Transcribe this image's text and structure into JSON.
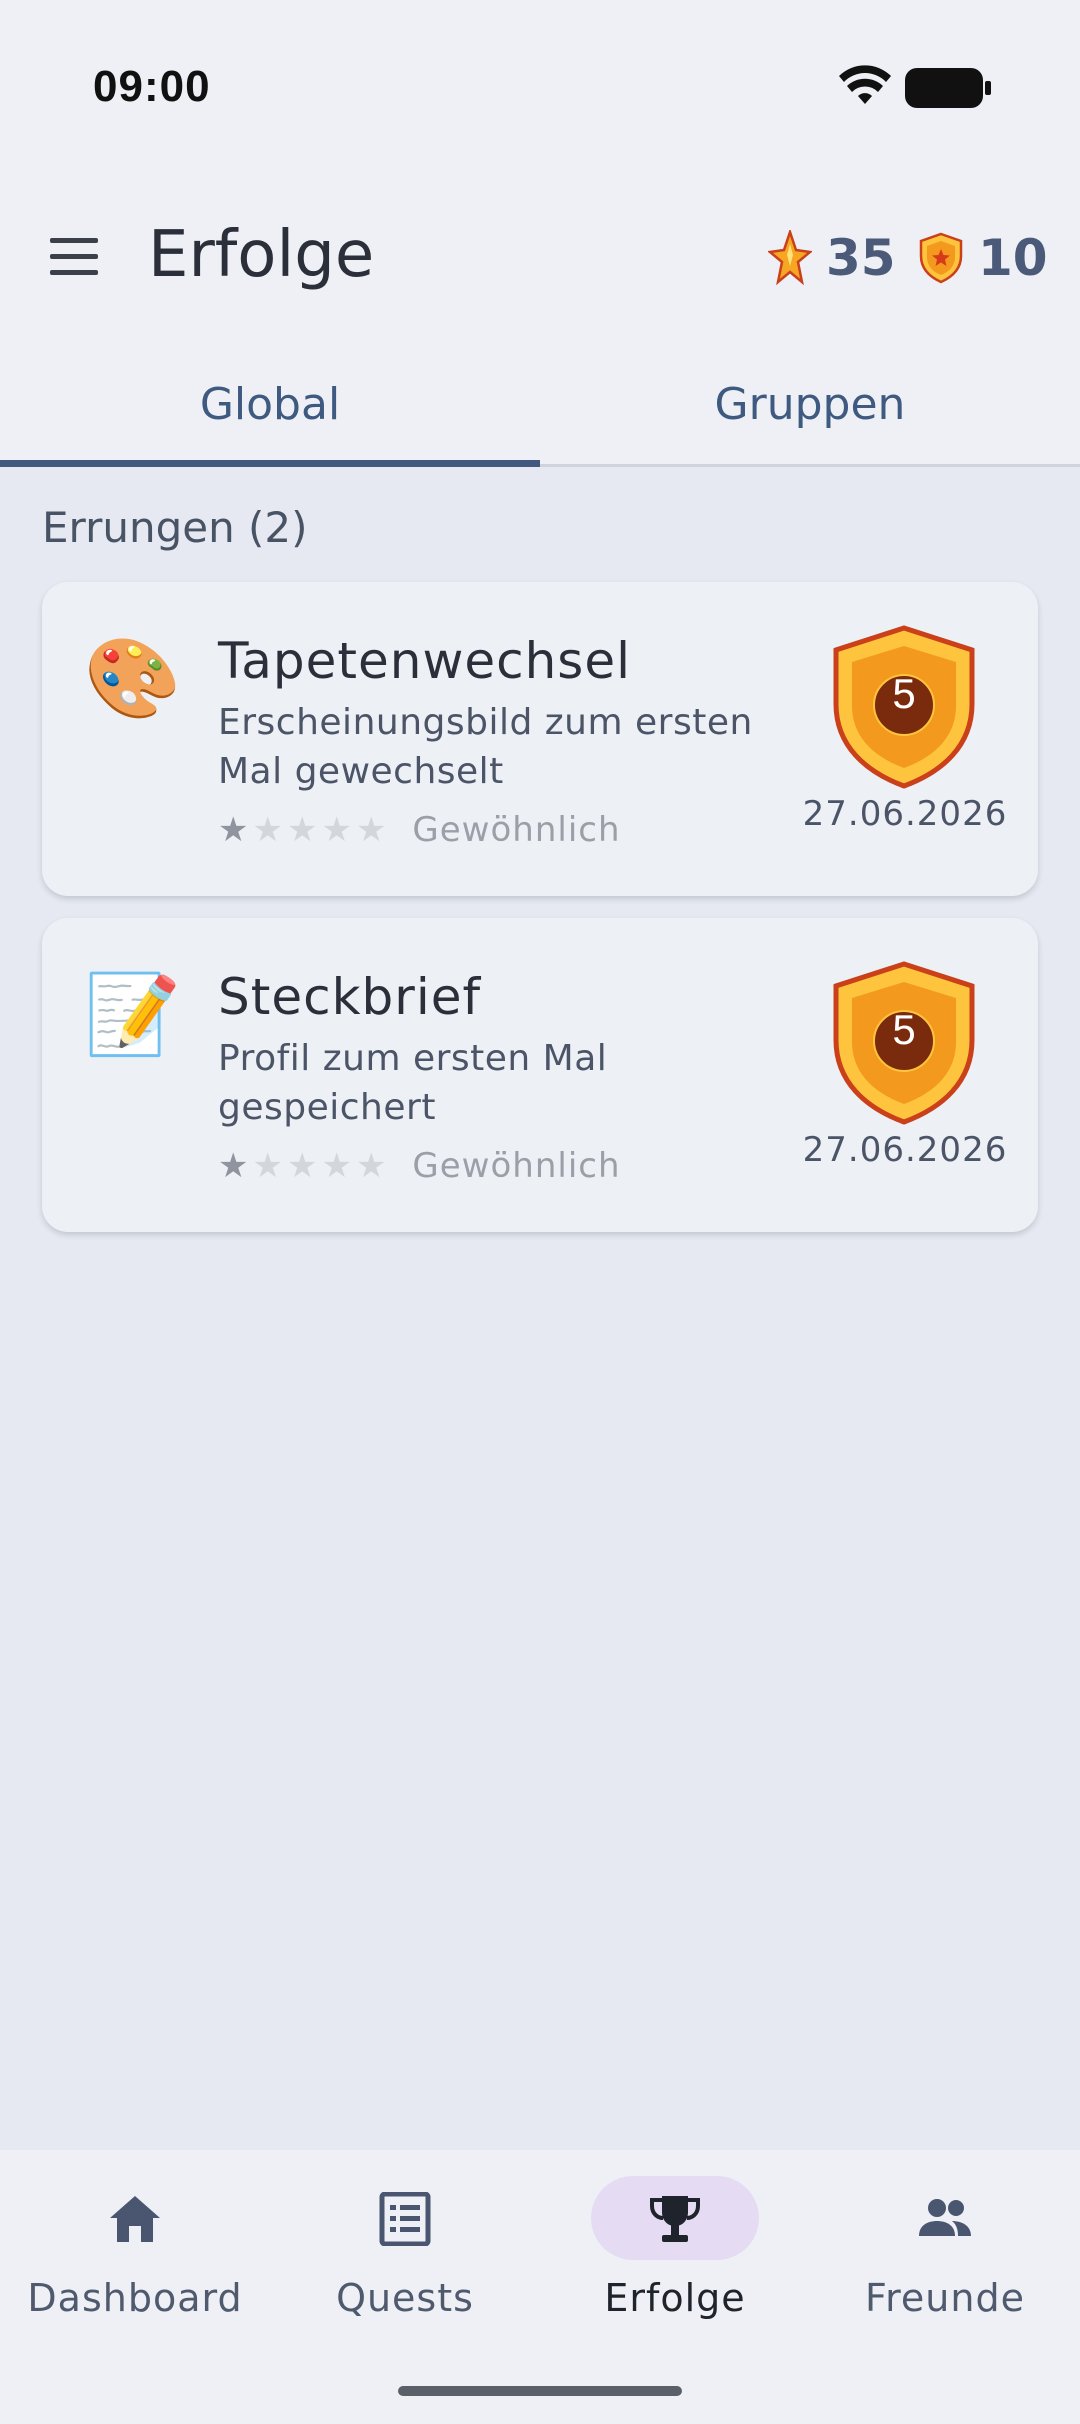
{
  "status_bar": {
    "time": "09:00",
    "wifi_icon": "wifi-icon",
    "battery_icon": "battery-icon"
  },
  "app_bar": {
    "menu_icon": "menu-icon",
    "title": "Erfolge",
    "points": {
      "icon": "star-medal-icon",
      "value": "35"
    },
    "badges": {
      "icon": "shield-badge-icon",
      "value": "10"
    }
  },
  "tabs": [
    {
      "label": "Global",
      "active": true
    },
    {
      "label": "Gruppen",
      "active": false
    }
  ],
  "section_header": "Errungen (2)",
  "achievements": [
    {
      "emoji": "🎨",
      "title": "Tapetenwechsel",
      "description": "Erscheinungsbild zum ersten Mal gewechselt",
      "stars_filled": 1,
      "stars_total": 5,
      "rarity": "Gewöhnlich",
      "medal_number": "5",
      "date": "27.06.2026"
    },
    {
      "emoji": "📝",
      "title": "Steckbrief",
      "description": "Profil zum ersten Mal gespeichert",
      "stars_filled": 1,
      "stars_total": 5,
      "rarity": "Gewöhnlich",
      "medal_number": "5",
      "date": "27.06.2026"
    }
  ],
  "bottom_nav": [
    {
      "label": "Dashboard",
      "icon": "home-icon",
      "active": false
    },
    {
      "label": "Quests",
      "icon": "list-icon",
      "active": false
    },
    {
      "label": "Erfolge",
      "icon": "trophy-icon",
      "active": true
    },
    {
      "label": "Freunde",
      "icon": "people-icon",
      "active": false
    }
  ],
  "colors": {
    "accent": "#41597f",
    "background": "#e6e9f1",
    "medal_orange": "#f39a1e",
    "medal_gold": "#ffc43d",
    "medal_dark": "#7a2a0d",
    "nav_active_pill": "#e5dcf3"
  }
}
